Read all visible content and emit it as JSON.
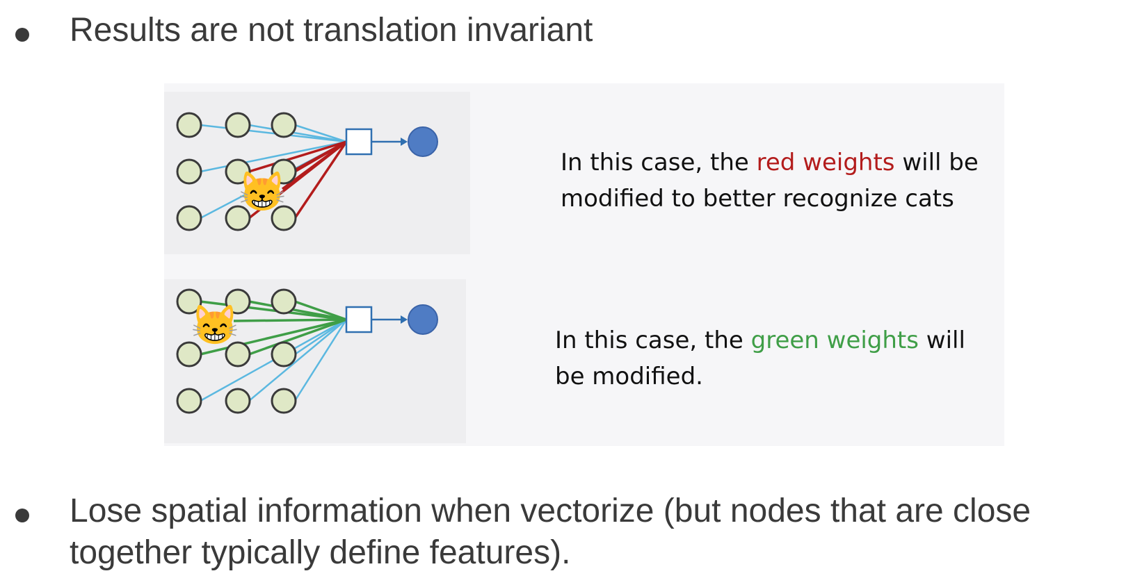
{
  "bullets": [
    {
      "text": "Results are not translation invariant"
    },
    {
      "text": "Lose spatial information when vectorize (but nodes that are close together typically define features)."
    }
  ],
  "figure": {
    "top_caption": {
      "before": "In this case, the ",
      "highlight": "red weights",
      "after": " will be modified to better recognize cats",
      "highlight_color": "#b31c1c"
    },
    "bottom_caption": {
      "before": "In this case, the ",
      "highlight": "green weights",
      "after": " will be modified.",
      "highlight_color": "#3f9e47"
    },
    "cat_icon": "😸",
    "colors": {
      "node_fill": "#dfe8c6",
      "node_stroke": "#3a3a3a",
      "plain_edge": "#5bb8e0",
      "output_node": "#4f7cc4",
      "square_stroke": "#2f6fb0"
    }
  }
}
